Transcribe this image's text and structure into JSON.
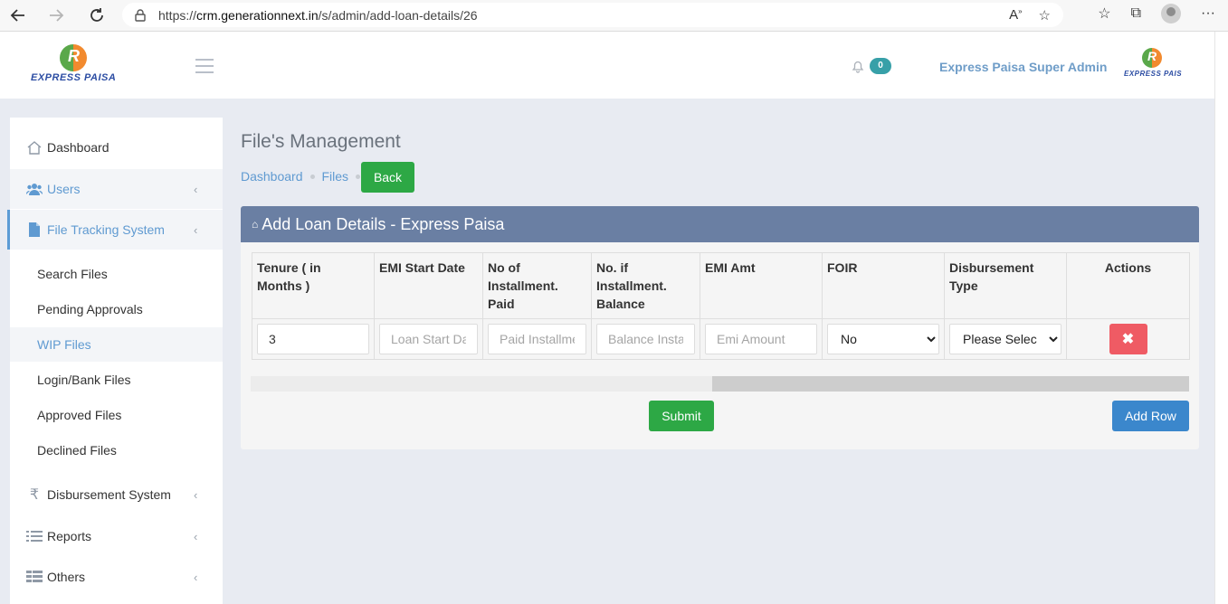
{
  "browser": {
    "url_prefix": "https://",
    "url_domain": "crm.generationnext.in",
    "url_path": "/s/admin/add-loan-details/26"
  },
  "header": {
    "logo_text": "EXPRESS PAISA",
    "logo_small_text": "EXPRESS PAIS",
    "notification_count": "0",
    "admin_name": "Express Paisa Super Admin"
  },
  "sidebar": {
    "items": [
      {
        "label": "Dashboard",
        "icon": "home-icon"
      },
      {
        "label": "Users",
        "icon": "users-icon"
      },
      {
        "label": "File Tracking System",
        "icon": "file-icon"
      },
      {
        "label": "Disbursement System",
        "icon": "rupee-icon"
      },
      {
        "label": "Reports",
        "icon": "list-icon"
      },
      {
        "label": "Others",
        "icon": "table-icon"
      }
    ],
    "subitems": [
      "Search Files",
      "Pending Approvals",
      "WIP Files",
      "Login/Bank Files",
      "Approved Files",
      "Declined Files"
    ]
  },
  "page": {
    "title": "File's Management",
    "breadcrumb": [
      "Dashboard",
      "Files"
    ],
    "back_label": "Back"
  },
  "panel": {
    "title": "Add Loan Details - Express Paisa",
    "columns": [
      "Tenure ( in Months )",
      "EMI Start Date",
      "No of Installment. Paid",
      "No. if Installment. Balance",
      "EMI Amt",
      "FOIR",
      "Disbursement Type",
      "Actions"
    ],
    "row": {
      "tenure_value": "3",
      "emi_start_placeholder": "Loan Start Date",
      "paid_placeholder": "Paid Installment",
      "balance_placeholder": "Balance Installment",
      "emi_amount_placeholder": "Emi Amount",
      "foir_selected": "No",
      "disbursement_selected": "Please Select"
    },
    "delete_symbol": "✖",
    "submit_label": "Submit",
    "add_row_label": "Add Row"
  }
}
